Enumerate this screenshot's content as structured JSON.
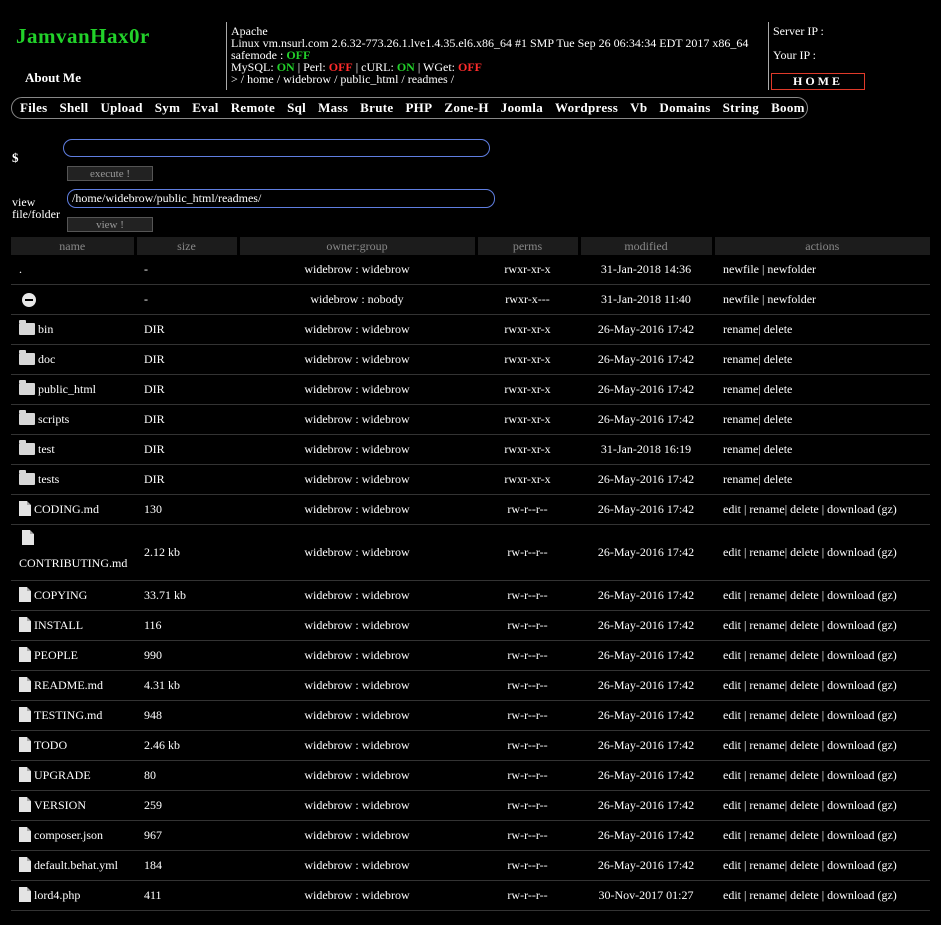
{
  "header": {
    "brand": "JamvanHax0r",
    "about": "About Me",
    "server_software": "Apache",
    "uname": "Linux vm.nsurl.com 2.6.32-773.26.1.lve1.4.35.el6.x86_64 #1 SMP Tue Sep 26 06:34:34 EDT 2017 x86_64",
    "safemode_label": "safemode :",
    "safemode_value": "OFF",
    "mysql_label": "MySQL:",
    "mysql_value": "ON",
    "perl_label": "| Perl:",
    "perl_value": "OFF",
    "curl_label": "| cURL:",
    "curl_value": "ON",
    "wget_label": "| WGet:",
    "wget_value": "OFF",
    "breadcrumb": ">  / home / widebrow / public_html / readmes /",
    "server_ip_label": "Server IP :",
    "your_ip_label": "Your IP :",
    "home_button": "HOME"
  },
  "menu": [
    "Files",
    "Shell",
    "Upload",
    "Sym",
    "Eval",
    "Remote",
    "Sql",
    "Mass",
    "Brute",
    "PHP",
    "Zone-H",
    "Joomla",
    "Wordpress",
    "Vb",
    "Domains",
    "String",
    "Boom"
  ],
  "command": {
    "prompt": "$",
    "value": "",
    "execute_label": "execute !"
  },
  "view": {
    "label_line1": "view",
    "label_line2": "file/folder",
    "path": "/home/widebrow/public_html/readmes/",
    "view_label": "view !"
  },
  "table": {
    "headers": [
      "name",
      "size",
      "owner:group",
      "perms",
      "modified",
      "actions"
    ],
    "rows": [
      {
        "icon": "none",
        "name": ".",
        "size": "-",
        "owner": "widebrow : widebrow",
        "perms": "rwxr-xr-x",
        "modified": "31-Jan-2018 14:36",
        "actions": "newfile | newfolder"
      },
      {
        "icon": "parent",
        "name": "",
        "size": "-",
        "owner": "widebrow : nobody",
        "perms": "rwxr-x---",
        "modified": "31-Jan-2018 11:40",
        "actions": "newfile | newfolder"
      },
      {
        "icon": "folder",
        "name": "bin",
        "size": "DIR",
        "owner": "widebrow : widebrow",
        "perms": "rwxr-xr-x",
        "modified": "26-May-2016 17:42",
        "actions": "rename| delete"
      },
      {
        "icon": "folder",
        "name": "doc",
        "size": "DIR",
        "owner": "widebrow : widebrow",
        "perms": "rwxr-xr-x",
        "modified": "26-May-2016 17:42",
        "actions": "rename| delete"
      },
      {
        "icon": "folder",
        "name": "public_html",
        "size": "DIR",
        "owner": "widebrow : widebrow",
        "perms": "rwxr-xr-x",
        "modified": "26-May-2016 17:42",
        "actions": "rename| delete"
      },
      {
        "icon": "folder",
        "name": "scripts",
        "size": "DIR",
        "owner": "widebrow : widebrow",
        "perms": "rwxr-xr-x",
        "modified": "26-May-2016 17:42",
        "actions": "rename| delete"
      },
      {
        "icon": "folder",
        "name": "test",
        "size": "DIR",
        "owner": "widebrow : widebrow",
        "perms": "rwxr-xr-x",
        "modified": "31-Jan-2018 16:19",
        "actions": "rename| delete"
      },
      {
        "icon": "folder",
        "name": "tests",
        "size": "DIR",
        "owner": "widebrow : widebrow",
        "perms": "rwxr-xr-x",
        "modified": "26-May-2016 17:42",
        "actions": "rename| delete"
      },
      {
        "icon": "file",
        "name": "CODING.md",
        "size": "130",
        "owner": "widebrow : widebrow",
        "perms": "rw-r--r--",
        "modified": "26-May-2016 17:42",
        "actions": "edit | rename| delete | download (gz)"
      },
      {
        "icon": "file",
        "name": "CONTRIBUTING.md",
        "size": "2.12 kb",
        "owner": "widebrow : widebrow",
        "perms": "rw-r--r--",
        "modified": "26-May-2016 17:42",
        "actions": "edit | rename| delete | download (gz)",
        "tall": true
      },
      {
        "icon": "file",
        "name": "COPYING",
        "size": "33.71 kb",
        "owner": "widebrow : widebrow",
        "perms": "rw-r--r--",
        "modified": "26-May-2016 17:42",
        "actions": "edit | rename| delete | download (gz)"
      },
      {
        "icon": "file",
        "name": "INSTALL",
        "size": "116",
        "owner": "widebrow : widebrow",
        "perms": "rw-r--r--",
        "modified": "26-May-2016 17:42",
        "actions": "edit | rename| delete | download (gz)"
      },
      {
        "icon": "file",
        "name": "PEOPLE",
        "size": "990",
        "owner": "widebrow : widebrow",
        "perms": "rw-r--r--",
        "modified": "26-May-2016 17:42",
        "actions": "edit | rename| delete | download (gz)"
      },
      {
        "icon": "file",
        "name": "README.md",
        "size": "4.31 kb",
        "owner": "widebrow : widebrow",
        "perms": "rw-r--r--",
        "modified": "26-May-2016 17:42",
        "actions": "edit | rename| delete | download (gz)"
      },
      {
        "icon": "file",
        "name": "TESTING.md",
        "size": "948",
        "owner": "widebrow : widebrow",
        "perms": "rw-r--r--",
        "modified": "26-May-2016 17:42",
        "actions": "edit | rename| delete | download (gz)"
      },
      {
        "icon": "file",
        "name": "TODO",
        "size": "2.46 kb",
        "owner": "widebrow : widebrow",
        "perms": "rw-r--r--",
        "modified": "26-May-2016 17:42",
        "actions": "edit | rename| delete | download (gz)"
      },
      {
        "icon": "file",
        "name": "UPGRADE",
        "size": "80",
        "owner": "widebrow : widebrow",
        "perms": "rw-r--r--",
        "modified": "26-May-2016 17:42",
        "actions": "edit | rename| delete | download (gz)"
      },
      {
        "icon": "file",
        "name": "VERSION",
        "size": "259",
        "owner": "widebrow : widebrow",
        "perms": "rw-r--r--",
        "modified": "26-May-2016 17:42",
        "actions": "edit | rename| delete | download (gz)"
      },
      {
        "icon": "file",
        "name": "composer.json",
        "size": "967",
        "owner": "widebrow : widebrow",
        "perms": "rw-r--r--",
        "modified": "26-May-2016 17:42",
        "actions": "edit | rename| delete | download (gz)"
      },
      {
        "icon": "file",
        "name": "default.behat.yml",
        "size": "184",
        "owner": "widebrow : widebrow",
        "perms": "rw-r--r--",
        "modified": "26-May-2016 17:42",
        "actions": "edit | rename| delete | download (gz)"
      },
      {
        "icon": "file",
        "name": "lord4.php",
        "size": "411",
        "owner": "widebrow : widebrow",
        "perms": "rw-r--r--",
        "modified": "30-Nov-2017 01:27",
        "actions": "edit | rename| delete | download (gz)"
      }
    ]
  },
  "colors": {
    "brand": "#22d12a",
    "on": "#22d12a",
    "off": "#ff2b2b",
    "home_border": "#e03a2a",
    "input_border": "#5f7ee0"
  }
}
